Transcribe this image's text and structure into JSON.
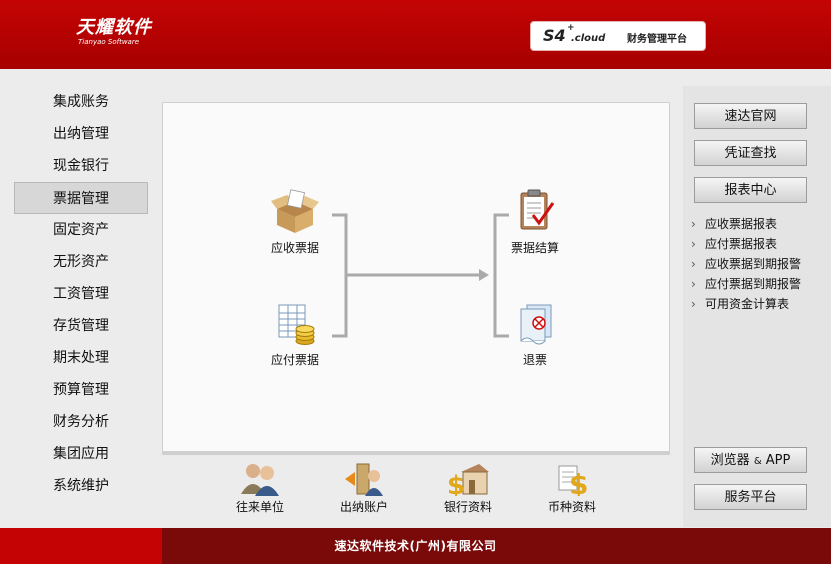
{
  "header": {
    "logo_main": "天耀软件",
    "logo_sub": "Tianyao Software",
    "platform_product": "S4",
    "platform_plus": "+",
    "platform_cloud": ".cloud",
    "platform_name": "财务管理平台"
  },
  "sidebar": {
    "items": [
      {
        "label": "集成账务"
      },
      {
        "label": "出纳管理"
      },
      {
        "label": "现金银行"
      },
      {
        "label": "票据管理",
        "active": true
      },
      {
        "label": "固定资产"
      },
      {
        "label": "无形资产"
      },
      {
        "label": "工资管理"
      },
      {
        "label": "存货管理"
      },
      {
        "label": "期末处理"
      },
      {
        "label": "预算管理"
      },
      {
        "label": "财务分析"
      },
      {
        "label": "集团应用"
      },
      {
        "label": "系统维护"
      }
    ]
  },
  "flow": {
    "receivable": "应收票据",
    "payable": "应付票据",
    "settle": "票据结算",
    "refund": "退票"
  },
  "bottom": {
    "items": [
      {
        "label": "往来单位",
        "icon": "contacts-icon"
      },
      {
        "label": "出纳账户",
        "icon": "cashier-account-icon"
      },
      {
        "label": "银行资料",
        "icon": "bank-icon"
      },
      {
        "label": "币种资料",
        "icon": "currency-icon"
      }
    ]
  },
  "right": {
    "official_site": "速达官网",
    "voucher_search": "凭证查找",
    "report_center": "报表中心",
    "reports": [
      "应收票据报表",
      "应付票据报表",
      "应收票据到期报警",
      "应付票据到期报警",
      "可用资金计算表"
    ],
    "browser_app": "浏览器",
    "browser_amp": "&",
    "browser_app2": "APP",
    "service_platform": "服务平台"
  },
  "footer": {
    "company": "速达软件技术(广州)有限公司"
  },
  "colors": {
    "brand_red": "#c40404",
    "footer_dark": "#7a0a0a"
  }
}
